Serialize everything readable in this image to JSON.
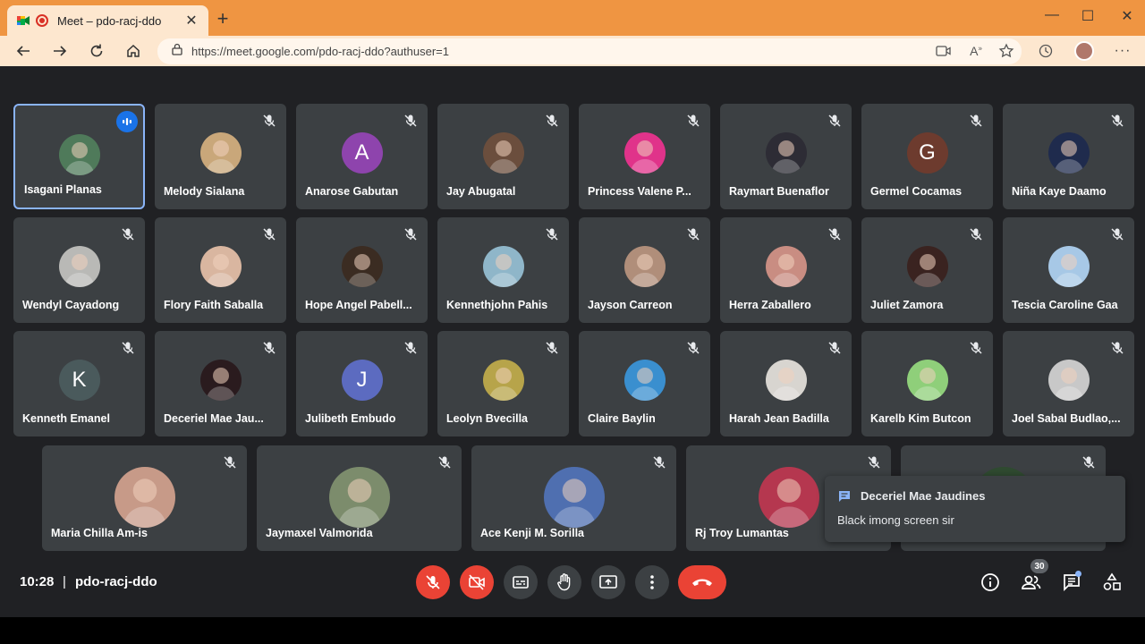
{
  "browser": {
    "tab_title": "Meet – pdo-racj-ddo",
    "url": "https://meet.google.com/pdo-racj-ddo?authuser=1",
    "accent": "#ef9542"
  },
  "participants": [
    {
      "name": "Isagani Planas",
      "avatar": "photo",
      "color": "#4f7a5a",
      "speaking": true
    },
    {
      "name": "Melody Sialana",
      "avatar": "photo",
      "color": "#c9a77a"
    },
    {
      "name": "Anarose Gabutan",
      "avatar": "A",
      "color": "#8e44ad"
    },
    {
      "name": "Jay Abugatal",
      "avatar": "photo",
      "color": "#6b4e3d"
    },
    {
      "name": "Princess Valene P...",
      "avatar": "photo",
      "color": "#e0338a"
    },
    {
      "name": "Raymart Buenaflor",
      "avatar": "photo",
      "color": "#2d2c35"
    },
    {
      "name": "Germel Cocamas",
      "avatar": "G",
      "color": "#6d3b2e"
    },
    {
      "name": "Niña Kaye Daamo",
      "avatar": "photo",
      "color": "#1f2b4d"
    },
    {
      "name": "Wendyl Cayadong",
      "avatar": "photo",
      "color": "#b9b9b6"
    },
    {
      "name": "Flory Faith Saballa",
      "avatar": "photo",
      "color": "#d9b6a0"
    },
    {
      "name": "Hope Angel Pabell...",
      "avatar": "photo",
      "color": "#3b2c22"
    },
    {
      "name": "Kennethjohn Pahis",
      "avatar": "photo",
      "color": "#8fb6c9"
    },
    {
      "name": "Jayson Carreon",
      "avatar": "photo",
      "color": "#b08e7a"
    },
    {
      "name": "Herra Zaballero",
      "avatar": "photo",
      "color": "#c98d82"
    },
    {
      "name": "Juliet Zamora",
      "avatar": "photo",
      "color": "#3a2320"
    },
    {
      "name": "Tescia Caroline Gaa",
      "avatar": "photo",
      "color": "#a7c8e6"
    },
    {
      "name": "Kenneth Emanel",
      "avatar": "K",
      "color": "#4a5a5c"
    },
    {
      "name": "Deceriel Mae Jau...",
      "avatar": "photo",
      "color": "#2a1b1e"
    },
    {
      "name": "Julibeth Embudo",
      "avatar": "J",
      "color": "#5c6bc0"
    },
    {
      "name": "Leolyn Bvecilla",
      "avatar": "photo",
      "color": "#b7a44a"
    },
    {
      "name": "Claire Baylin",
      "avatar": "photo",
      "color": "#3a8fcf"
    },
    {
      "name": "Harah Jean Badilla",
      "avatar": "photo",
      "color": "#d8d5d0"
    },
    {
      "name": "Karelb Kim Butcon",
      "avatar": "photo",
      "color": "#8fcf7a"
    },
    {
      "name": "Joel Sabal Budlao,...",
      "avatar": "photo",
      "color": "#c8c8c8"
    },
    {
      "name": "Maria Chilla Am-is",
      "avatar": "photo",
      "color": "#c79a88"
    },
    {
      "name": "Jaymaxel Valmorida",
      "avatar": "photo",
      "color": "#7c8c6c"
    },
    {
      "name": "Ace Kenji M. Sorilla",
      "avatar": "photo",
      "color": "#4f6fb0"
    },
    {
      "name": "Rj Troy Lumantas",
      "avatar": "photo",
      "color": "#b5374f"
    },
    {
      "name": "",
      "avatar": "photo",
      "color": "#2f4a30"
    }
  ],
  "toast": {
    "sender": "Deceriel Mae Jaudines",
    "message": "Black imong screen sir"
  },
  "footer": {
    "time": "10:28",
    "separator": "|",
    "meeting_code": "pdo-racj-ddo",
    "people_count": "30"
  }
}
